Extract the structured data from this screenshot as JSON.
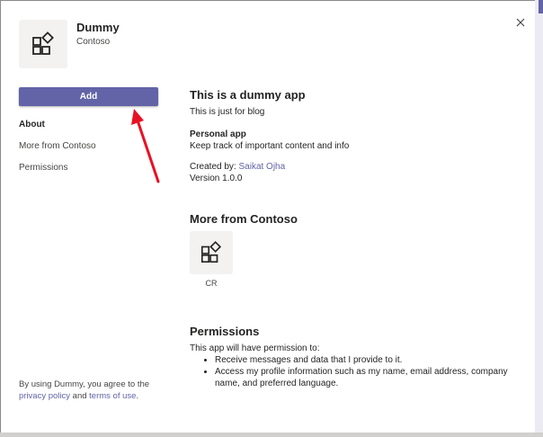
{
  "app": {
    "name": "Dummy",
    "publisher": "Contoso",
    "icon": "apps-icon"
  },
  "actions": {
    "add_label": "Add"
  },
  "nav": {
    "items": [
      {
        "label": "About",
        "active": true
      },
      {
        "label": "More from Contoso",
        "active": false
      },
      {
        "label": "Permissions",
        "active": false
      }
    ]
  },
  "footer": {
    "prefix": "By using Dummy, you agree to the",
    "privacy_link": "privacy policy",
    "and_text": "and",
    "terms_link": "terms of use",
    "period": "."
  },
  "about": {
    "title": "This is a dummy app",
    "description": "This is just for blog",
    "capability_title": "Personal app",
    "capability_desc": "Keep track of important content and info",
    "created_by_label": "Created by:",
    "created_by_name": "Saikat Ojha",
    "version": "Version 1.0.0"
  },
  "more": {
    "title": "More from Contoso",
    "apps": [
      {
        "label": "CR",
        "icon": "apps-icon"
      }
    ]
  },
  "permissions": {
    "title": "Permissions",
    "intro": "This app will have permission to:",
    "items": [
      "Receive messages and data that I provide to it.",
      "Access my profile information such as my name, email address, company name, and preferred language."
    ]
  },
  "colors": {
    "accent": "#6264a7",
    "tile_bg": "#f3f2f1",
    "annotation_arrow": "#e81123"
  }
}
